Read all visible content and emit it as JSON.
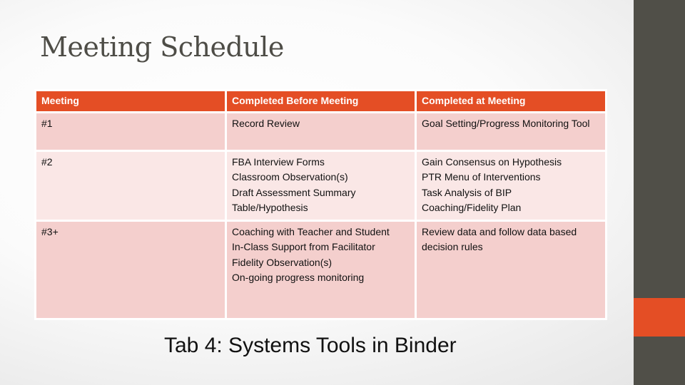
{
  "slide": {
    "title": "Meeting Schedule",
    "footer": "Tab 4: Systems Tools in Binder",
    "colors": {
      "accent": "#e44e25",
      "sidebar": "#504f48",
      "row_odd": "#f4cfcd",
      "row_even": "#fae7e6"
    }
  },
  "table": {
    "headers": [
      "Meeting",
      "Completed Before Meeting",
      "Completed at Meeting"
    ],
    "rows": [
      {
        "meeting": "#1",
        "before": [
          "Record Review"
        ],
        "at": [
          "Goal Setting/Progress Monitoring Tool"
        ]
      },
      {
        "meeting": "#2",
        "before": [
          "FBA Interview Forms",
          "Classroom Observation(s)",
          "Draft Assessment Summary Table/Hypothesis"
        ],
        "at": [
          "Gain Consensus on Hypothesis",
          "PTR Menu of Interventions",
          "Task Analysis of BIP",
          "Coaching/Fidelity Plan"
        ]
      },
      {
        "meeting": "#3+",
        "before": [
          "Coaching with Teacher and Student",
          "In-Class Support from Facilitator",
          "Fidelity Observation(s)",
          "On-going progress monitoring"
        ],
        "at": [
          "Review data and follow data based decision rules"
        ]
      }
    ]
  }
}
